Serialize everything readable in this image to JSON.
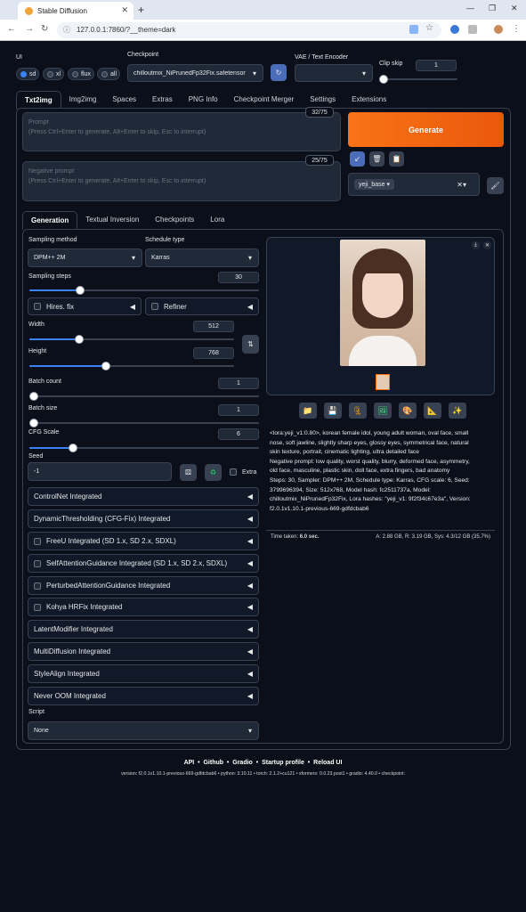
{
  "browser": {
    "tab_title": "Stable Diffusion",
    "url": "127.0.0.1:7860/?__theme=dark"
  },
  "top": {
    "ui_label": "UI",
    "ui_options": [
      "sd",
      "xl",
      "flux",
      "all"
    ],
    "checkpoint_label": "Checkpoint",
    "checkpoint_value": "chilloutmix_NiPrunedFp32Fix.safetensor",
    "vae_label": "VAE / Text Encoder",
    "clip_label": "Clip skip",
    "clip_value": "1"
  },
  "main_tabs": [
    "Txt2img",
    "Img2img",
    "Spaces",
    "Extras",
    "PNG Info",
    "Checkpoint Merger",
    "Settings",
    "Extensions"
  ],
  "prompt": {
    "placeholder1": "Prompt",
    "placeholder2": "(Press Ctrl+Enter to generate, Alt+Enter to skip, Esc to interrupt)",
    "count": "32/75"
  },
  "neg_prompt": {
    "placeholder1": "Negative prompt",
    "placeholder2": "(Press Ctrl+Enter to generate, Alt+Enter to skip, Esc to interrupt)",
    "count": "25/75"
  },
  "generate": "Generate",
  "style_value": "yeji_base",
  "sub_tabs": [
    "Generation",
    "Textual Inversion",
    "Checkpoints",
    "Lora"
  ],
  "params": {
    "sampling_method_label": "Sampling method",
    "sampling_method": "DPM++ 2M",
    "schedule_label": "Schedule type",
    "schedule": "Karras",
    "steps_label": "Sampling steps",
    "steps": "30",
    "hires": "Hires. fix",
    "refiner": "Refiner",
    "width_label": "Width",
    "width": "512",
    "height_label": "Height",
    "height": "768",
    "batch_count_label": "Batch count",
    "batch_count": "1",
    "batch_size_label": "Batch size",
    "batch_size": "1",
    "cfg_label": "CFG Scale",
    "cfg": "6",
    "seed_label": "Seed",
    "seed": "-1",
    "extra": "Extra",
    "script_label": "Script",
    "script": "None"
  },
  "slider_levels": {
    "steps": 0.2,
    "width": 0.22,
    "height": 0.35,
    "batch_count": 0.0,
    "batch_size": 0.0,
    "cfg": 0.17
  },
  "extensions": [
    {
      "label": "ControlNet Integrated",
      "checkbox": false
    },
    {
      "label": "DynamicThresholding (CFG-Fix) Integrated",
      "checkbox": false
    },
    {
      "label": "FreeU Integrated (SD 1.x, SD 2.x, SDXL)",
      "checkbox": true
    },
    {
      "label": "SelfAttentionGuidance Integrated (SD 1.x, SD 2.x, SDXL)",
      "checkbox": true
    },
    {
      "label": "PerturbedAttentionGuidance Integrated",
      "checkbox": true
    },
    {
      "label": "Kohya HRFix Integrated",
      "checkbox": true
    },
    {
      "label": "LatentModifier Integrated",
      "checkbox": false
    },
    {
      "label": "MultiDiffusion Integrated",
      "checkbox": false
    },
    {
      "label": "StyleAlign Integrated",
      "checkbox": false
    },
    {
      "label": "Never OOM Integrated",
      "checkbox": false
    }
  ],
  "output": {
    "info_lines": [
      "<lora:yeji_v1:0.80>, korean female idol, young adult woman, oval face, small",
      "nose, soft jawline, slightly sharp eyes, glossy eyes, symmetrical face, natural",
      "skin texture, portrait, cinematic lighting, ultra detailed face",
      "Negative prompt: low quality, worst quality, blurry, deformed face, asymmetry,",
      "old face, masculine, plastic skin, doll face, extra fingers, bad anatomy",
      "Steps: 30, Sampler: DPM++ 2M, Schedule type: Karras, CFG scale: 6, Seed:",
      "3799696394, Size: 512x768, Model hash: fc2511737a, Model:",
      "chilloutmix_NiPrunedFp32Fix, Lora hashes: \"yeji_v1: 9f2f34c67e3a\", Version:",
      "f2.0.1v1.10.1-previous-669-gdfdcbab6"
    ],
    "time_label": "Time taken:",
    "time": "6.0 sec.",
    "mem": "A: 2.88 GB, R: 3.19 GB, Sys: 4.3/12 GB (35.7%)"
  },
  "footer": {
    "links": [
      "API",
      "Github",
      "Gradio",
      "Startup profile",
      "Reload UI"
    ],
    "version": "version: f2.0.1v1.10.1-previous-669-gdfdcbab6  •  python: 3.10.11  •  torch: 2.1.2+cu121  •  xformers: 0.0.23.post1  •  gradio: 4.40.0  •  checkpoint:"
  },
  "colors": {
    "accent": "#f97316",
    "bg": "#0b0f19",
    "panel": "#111827",
    "blue": "#3b82f6"
  }
}
